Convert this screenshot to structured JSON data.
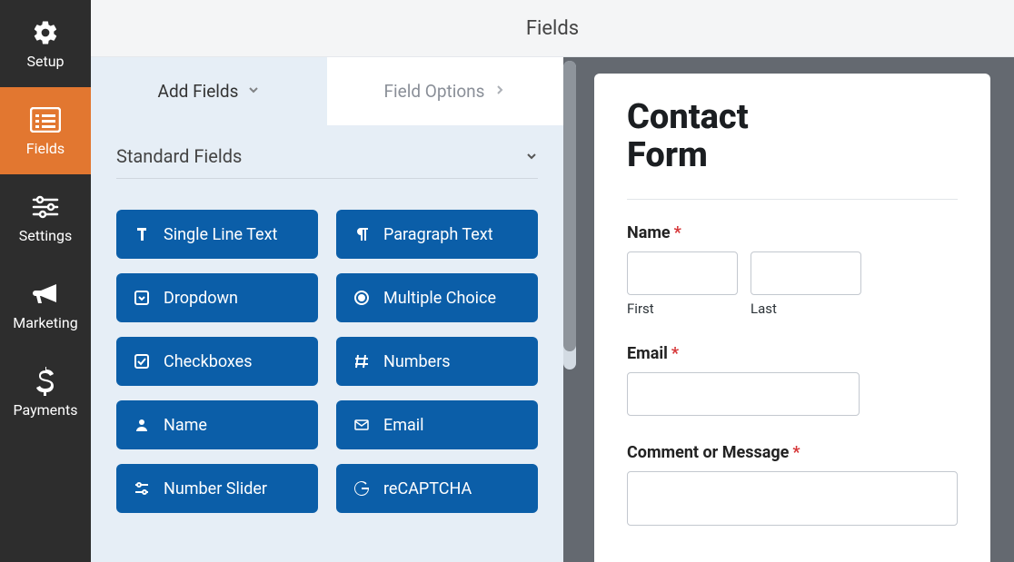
{
  "sidebar": {
    "items": [
      {
        "key": "setup",
        "label": "Setup"
      },
      {
        "key": "fields",
        "label": "Fields"
      },
      {
        "key": "settings",
        "label": "Settings"
      },
      {
        "key": "marketing",
        "label": "Marketing"
      },
      {
        "key": "payments",
        "label": "Payments"
      }
    ],
    "active": "fields"
  },
  "header": {
    "title": "Fields"
  },
  "tabs": {
    "add_fields": "Add Fields",
    "field_options": "Field Options"
  },
  "section": {
    "title": "Standard Fields"
  },
  "fields": {
    "single_line_text": "Single Line Text",
    "paragraph_text": "Paragraph Text",
    "dropdown": "Dropdown",
    "multiple_choice": "Multiple Choice",
    "checkboxes": "Checkboxes",
    "numbers": "Numbers",
    "name": "Name",
    "email": "Email",
    "number_slider": "Number Slider",
    "recaptcha": "reCAPTCHA"
  },
  "preview": {
    "title_line1": "Contact",
    "title_line2": "Form",
    "name_label": "Name",
    "first_label": "First",
    "last_label": "Last",
    "email_label": "Email",
    "message_label": "Comment or Message",
    "required_mark": "*"
  }
}
